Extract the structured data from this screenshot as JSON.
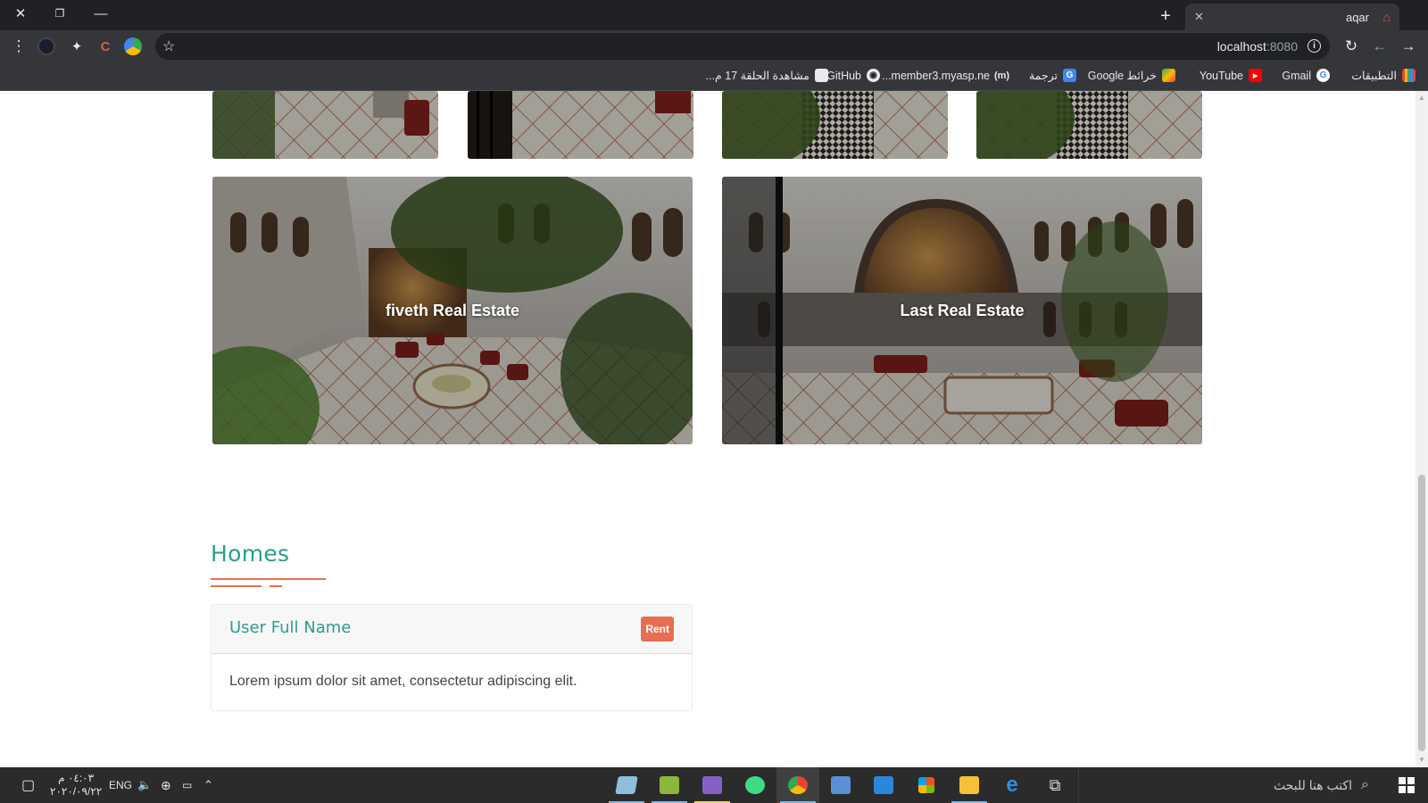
{
  "browser": {
    "tab_title": "aqar",
    "url_host": "localhost",
    "url_port": ":8080",
    "bookmarks": [
      {
        "label": "التطبيقات",
        "icon": "apps-grid-icon"
      },
      {
        "label": "Gmail",
        "icon": "google-icon"
      },
      {
        "label": "YouTube",
        "icon": "youtube-icon"
      },
      {
        "label": "خرائط Google",
        "icon": "google-maps-icon"
      },
      {
        "label": "ترجمة",
        "icon": "google-translate-icon"
      },
      {
        "label": "member3.myasp.ne...",
        "icon": "m-site-icon"
      },
      {
        "label": "GitHub",
        "icon": "github-icon"
      },
      {
        "label": "مشاهدة الحلقة 17 م...",
        "icon": "video-site-icon"
      }
    ]
  },
  "gallery": {
    "tiles": [
      {
        "caption": "fiveth Real Estate"
      },
      {
        "caption": "Last Real Estate"
      }
    ]
  },
  "homes": {
    "title": "Homes",
    "card": {
      "user": "User Full Name",
      "badge": "Rent",
      "body": "Lorem ipsum dolor sit amet, consectetur adipiscing elit."
    }
  },
  "taskbar": {
    "search_placeholder": "اكتب هنا للبحث",
    "language": "ENG",
    "time": "٠٤:٠٣ م",
    "date": "٢٠٢٠/٠٩/٢٢"
  }
}
